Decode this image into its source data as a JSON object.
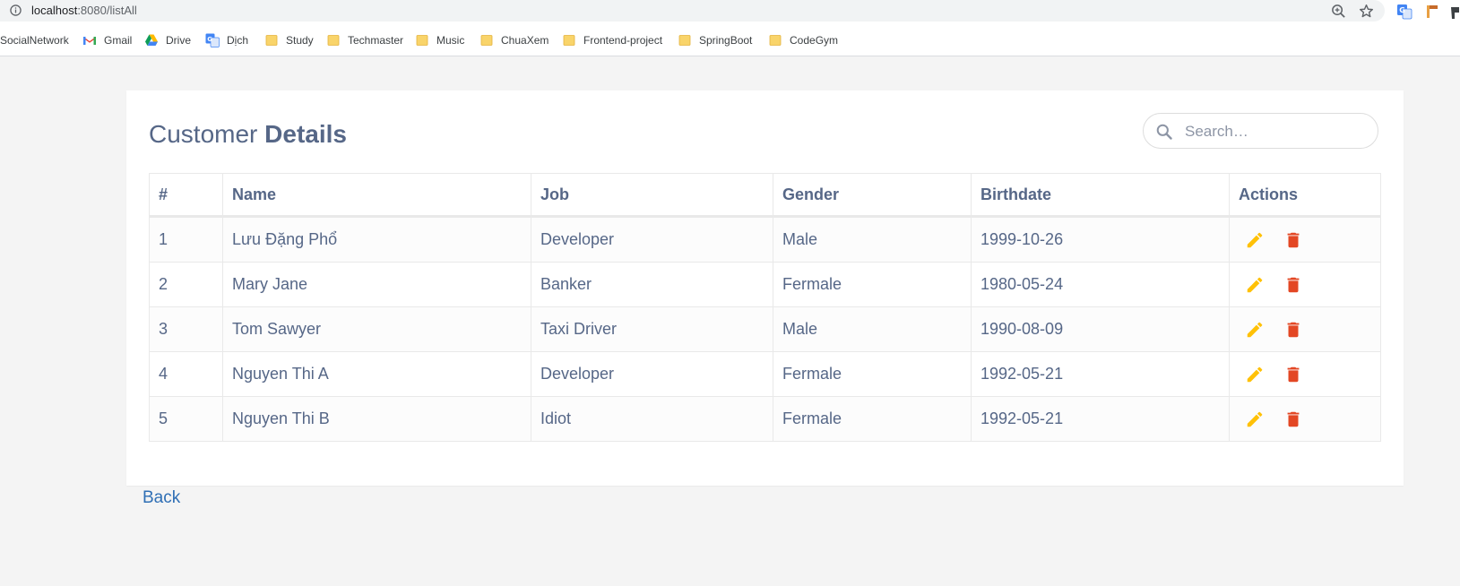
{
  "browser": {
    "url_host": "localhost",
    "url_rest": ":8080/listAll",
    "bookmarks": [
      {
        "label": "SocialNetwork",
        "icon": "none"
      },
      {
        "label": "Gmail",
        "icon": "gmail-icon"
      },
      {
        "label": "Drive",
        "icon": "drive-icon"
      },
      {
        "label": "Dịch",
        "icon": "translate-icon"
      },
      {
        "label": "Study",
        "icon": "folder-icon"
      },
      {
        "label": "Techmaster",
        "icon": "folder-icon"
      },
      {
        "label": "Music",
        "icon": "folder-icon"
      },
      {
        "label": "ChuaXem",
        "icon": "folder-icon"
      },
      {
        "label": "Frontend-project",
        "icon": "folder-icon"
      },
      {
        "label": "SpringBoot",
        "icon": "folder-icon"
      },
      {
        "label": "CodeGym",
        "icon": "folder-icon"
      }
    ]
  },
  "page": {
    "title_light": "Customer",
    "title_bold": "Details",
    "search_placeholder": "Search…",
    "back_label": "Back"
  },
  "table": {
    "headers": [
      "#",
      "Name",
      "Job",
      "Gender",
      "Birthdate",
      "Actions"
    ],
    "rows": [
      {
        "id": "1",
        "name": "Lưu Đặng Phổ",
        "job": "Developer",
        "gender": "Male",
        "birthdate": "1999-10-26"
      },
      {
        "id": "2",
        "name": "Mary Jane",
        "job": "Banker",
        "gender": "Fermale",
        "birthdate": "1980-05-24"
      },
      {
        "id": "3",
        "name": "Tom Sawyer",
        "job": "Taxi Driver",
        "gender": "Male",
        "birthdate": "1990-08-09"
      },
      {
        "id": "4",
        "name": "Nguyen Thi A",
        "job": "Developer",
        "gender": "Fermale",
        "birthdate": "1992-05-21"
      },
      {
        "id": "5",
        "name": "Nguyen Thi B",
        "job": "Idiot",
        "gender": "Fermale",
        "birthdate": "1992-05-21"
      }
    ],
    "row_actions": [
      "edit-pencil-icon",
      "delete-trash-icon"
    ]
  },
  "colors": {
    "text": "#566787",
    "edit": "#ffc107",
    "delete": "#e34724",
    "link": "#2f6fb5",
    "background": "#f4f4f4"
  }
}
